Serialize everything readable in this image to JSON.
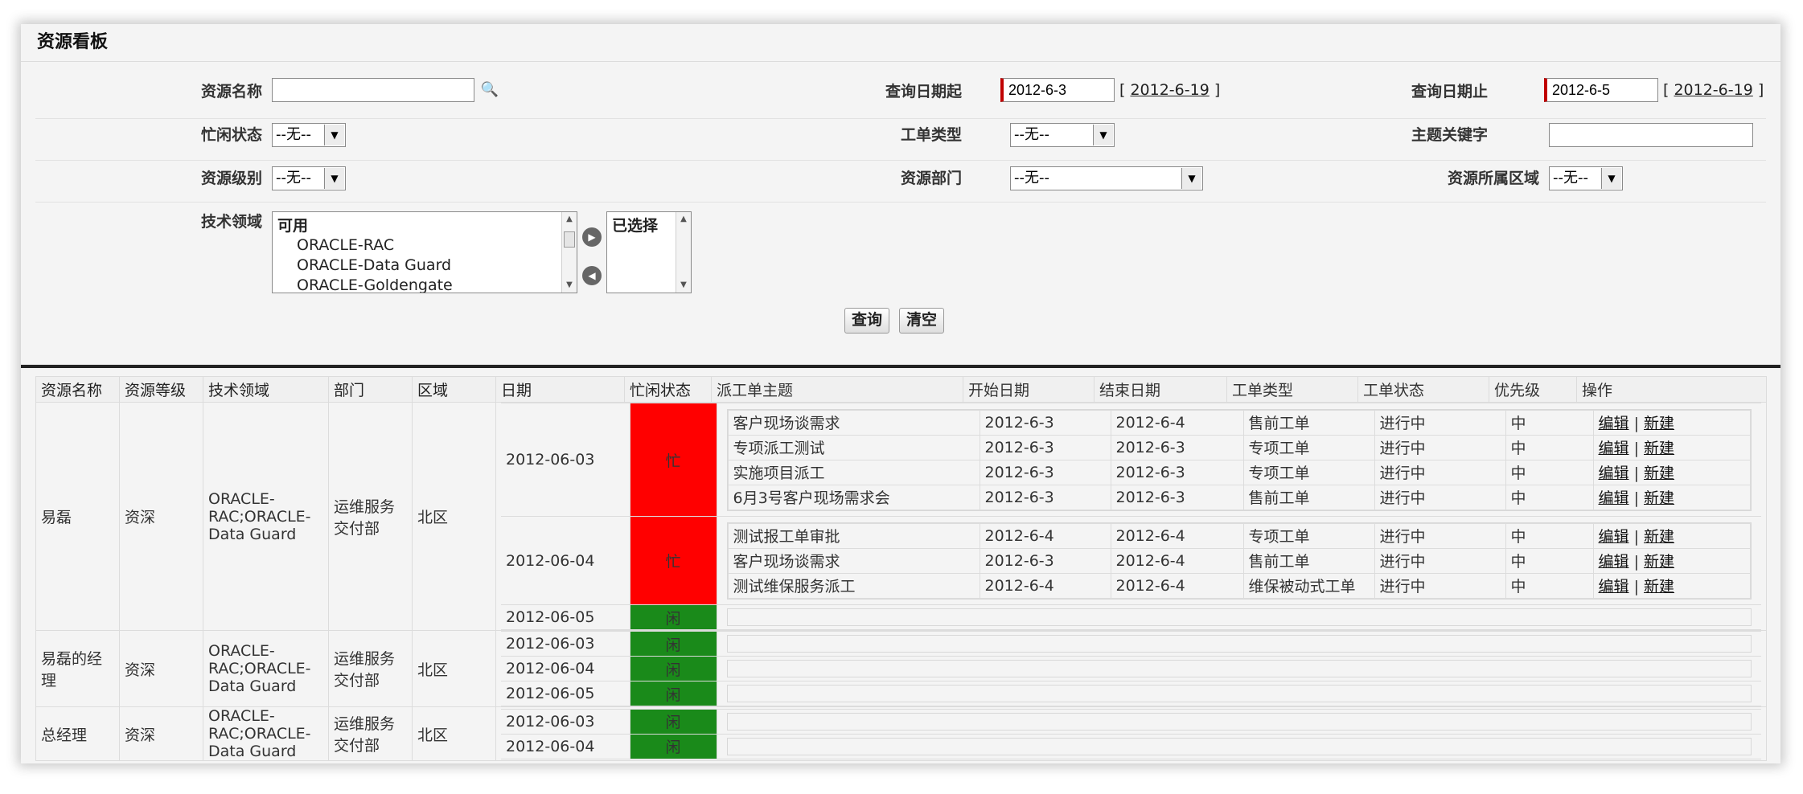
{
  "page": {
    "title": "资源看板"
  },
  "search": {
    "resource_name_label": "资源名称",
    "resource_name_value": "",
    "query_start_label": "查询日期起",
    "query_start_value": "2012-6-3",
    "query_start_today": "2012-6-19",
    "query_end_label": "查询日期止",
    "query_end_value": "2012-6-5",
    "query_end_today": "2012-6-19",
    "busy_status_label": "忙闲状态",
    "busy_status_value": "--无--",
    "ticket_type_label": "工单类型",
    "ticket_type_value": "--无--",
    "subject_keyword_label": "主题关键字",
    "subject_keyword_value": "",
    "resource_level_label": "资源级别",
    "resource_level_value": "--无--",
    "resource_dept_label": "资源部门",
    "resource_dept_value": "--无--",
    "resource_region_label": "资源所属区域",
    "resource_region_value": "--无--",
    "tech_field_label": "技术领域",
    "available_group": "可用",
    "available_options": [
      "ORACLE-RAC",
      "ORACLE-Data Guard",
      "ORACLE-Goldengate"
    ],
    "selected_group": "已选择",
    "query_button": "查询",
    "clear_button": "清空"
  },
  "results": {
    "columns": [
      "资源名称",
      "资源等级",
      "技术领域",
      "部门",
      "区域",
      "日期",
      "忙闲状态",
      "派工单主题",
      "开始日期",
      "结束日期",
      "工单类型",
      "工单状态",
      "优先级",
      "操作"
    ],
    "edit_label": "编辑",
    "new_label": "新建",
    "separator": "|",
    "resources": [
      {
        "name": "易磊",
        "level": "资深",
        "tech": "ORACLE-RAC;ORACLE-Data Guard",
        "dept": "运维服务交付部",
        "region": "北区",
        "days": [
          {
            "date": "2012-06-03",
            "status": "忙",
            "tasks": [
              {
                "subject": "客户现场谈需求",
                "start": "2012-6-3",
                "end": "2012-6-4",
                "type": "售前工单",
                "state": "进行中",
                "priority": "中"
              },
              {
                "subject": "专项派工测试",
                "start": "2012-6-3",
                "end": "2012-6-3",
                "type": "专项工单",
                "state": "进行中",
                "priority": "中"
              },
              {
                "subject": "实施项目派工",
                "start": "2012-6-3",
                "end": "2012-6-3",
                "type": "专项工单",
                "state": "进行中",
                "priority": "中"
              },
              {
                "subject": "6月3号客户现场需求会",
                "start": "2012-6-3",
                "end": "2012-6-3",
                "type": "售前工单",
                "state": "进行中",
                "priority": "中"
              }
            ]
          },
          {
            "date": "2012-06-04",
            "status": "忙",
            "tasks": [
              {
                "subject": "测试报工单审批",
                "start": "2012-6-4",
                "end": "2012-6-4",
                "type": "专项工单",
                "state": "进行中",
                "priority": "中"
              },
              {
                "subject": "客户现场谈需求",
                "start": "2012-6-3",
                "end": "2012-6-4",
                "type": "售前工单",
                "state": "进行中",
                "priority": "中"
              },
              {
                "subject": "测试维保服务派工",
                "start": "2012-6-4",
                "end": "2012-6-4",
                "type": "维保被动式工单",
                "state": "进行中",
                "priority": "中"
              }
            ]
          },
          {
            "date": "2012-06-05",
            "status": "闲",
            "tasks": []
          }
        ]
      },
      {
        "name": "易磊的经理",
        "level": "资深",
        "tech": "ORACLE-RAC;ORACLE-Data Guard",
        "dept": "运维服务交付部",
        "region": "北区",
        "days": [
          {
            "date": "2012-06-03",
            "status": "闲",
            "tasks": []
          },
          {
            "date": "2012-06-04",
            "status": "闲",
            "tasks": []
          },
          {
            "date": "2012-06-05",
            "status": "闲",
            "tasks": []
          }
        ]
      },
      {
        "name": "总经理",
        "level": "资深",
        "tech": "ORACLE-RAC;ORACLE-Data Guard",
        "dept": "运维服务交付部",
        "region": "北区",
        "days": [
          {
            "date": "2012-06-03",
            "status": "闲",
            "tasks": []
          },
          {
            "date": "2012-06-04",
            "status": "闲",
            "tasks": []
          }
        ]
      }
    ]
  },
  "colors": {
    "busy": "#ff0000",
    "idle": "#1a8a1a",
    "required": "#c00000"
  }
}
